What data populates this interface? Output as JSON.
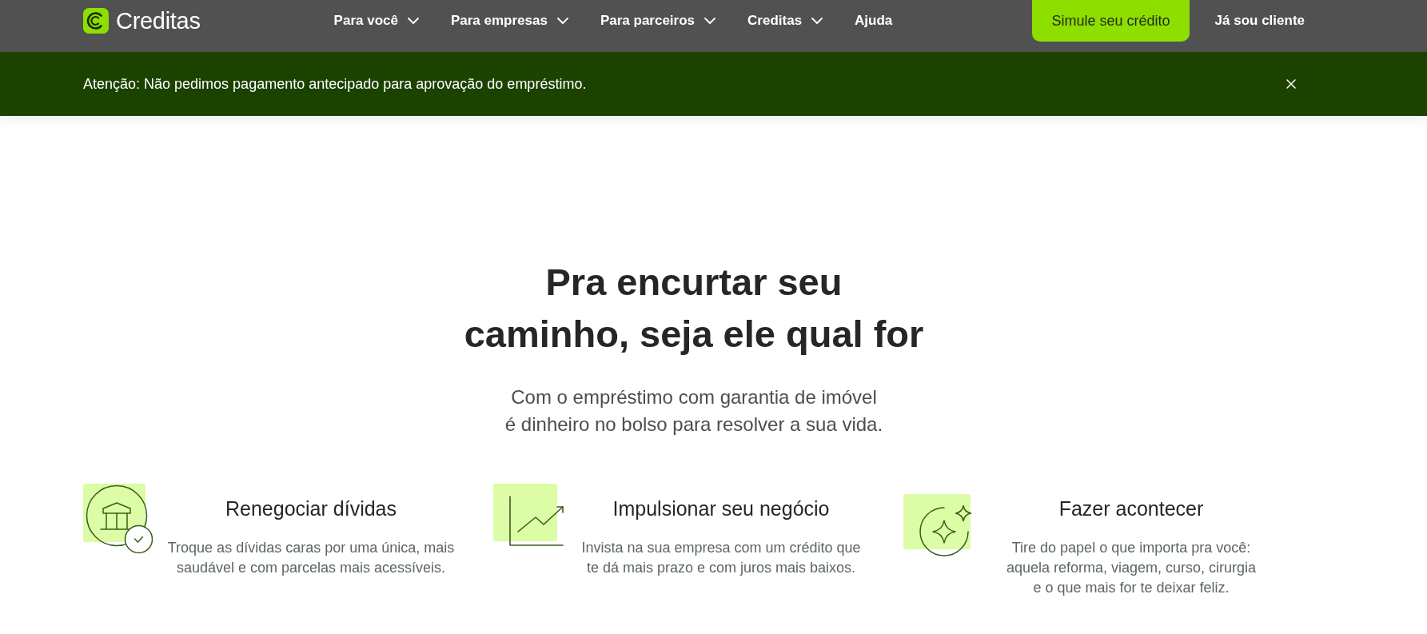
{
  "header": {
    "brand": "Creditas",
    "nav": [
      {
        "label": "Para você",
        "kind": "menu"
      },
      {
        "label": "Para empresas",
        "kind": "menu"
      },
      {
        "label": "Para parceiros",
        "kind": "menu"
      },
      {
        "label": "Creditas",
        "kind": "menu"
      },
      {
        "label": "Ajuda",
        "kind": "link"
      }
    ],
    "cta": "Simule seu crédito",
    "login": "Já sou cliente"
  },
  "notice": {
    "text": "Atenção: Não pedimos pagamento antecipado para aprovação do empréstimo."
  },
  "hero": {
    "title": "Pra encurtar seu caminho, seja ele qual for",
    "subtitle": "Com o empréstimo com garantia de imóvel é dinheiro no bolso para resolver a sua vida."
  },
  "features": [
    {
      "kind": "bank",
      "title": "Renegociar dívidas",
      "text": "Troque as dívidas caras por uma única, mais saudável e com parcelas mais acessíveis."
    },
    {
      "kind": "chart",
      "title": "Impulsionar seu negócio",
      "text": "Invista na sua empresa com um crédito que te dá mais prazo e com juros mais baixos."
    },
    {
      "kind": "sparkle",
      "title": "Fazer acontecer",
      "text": "Tire do papel o que importa pra você: aquela reforma, viagem, curso, cirurgia e o que mais for te deixar feliz."
    }
  ]
}
